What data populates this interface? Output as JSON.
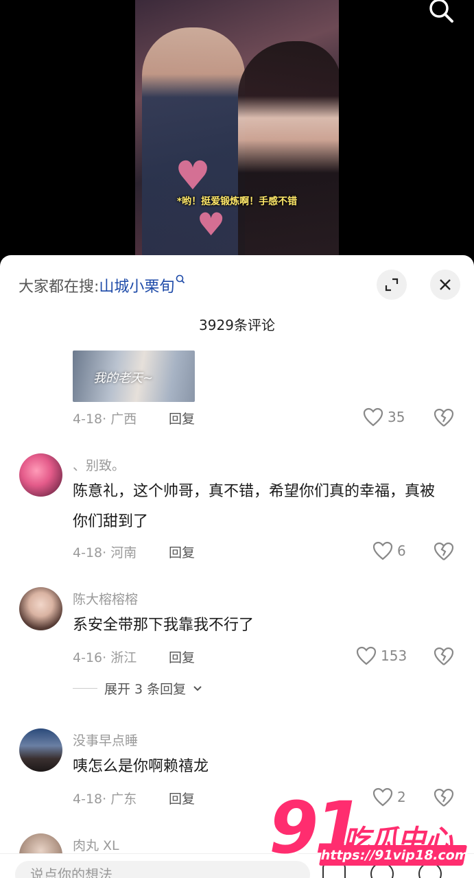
{
  "video": {
    "caption": "*哟！挺爱锻炼啊！手感不错"
  },
  "sheet": {
    "search_prefix": "大家都在搜:",
    "search_keyword": "山城小栗旬",
    "comment_count_title": "3929条评论",
    "reply_label": "回复"
  },
  "comments": [
    {
      "image_caption": "我的老天~",
      "meta": "4-18· 广西",
      "likes": "35"
    },
    {
      "username": "、别致。",
      "text": "陈意礼，这个帅哥，真不错，希望你们真的幸福，真被你们甜到了",
      "meta": "4-18· 河南",
      "likes": "6"
    },
    {
      "username": "陈大榕榕榕",
      "text": "系安全带那下我靠我不行了",
      "meta": "4-16· 浙江",
      "likes": "153",
      "expand_label": "展开 3 条回复"
    },
    {
      "username": "没事早点睡",
      "text": "咦怎么是你啊赖禧龙",
      "meta": "4-18· 广东",
      "likes": "2"
    },
    {
      "username": "肉丸 XL"
    }
  ],
  "bottom": {
    "input_placeholder": "说点你的想法"
  },
  "watermark": {
    "number": "91",
    "brand": "吃瓜中心",
    "url": "https://91vip18.com"
  },
  "colors": {
    "accent_link": "#1d4aa8",
    "watermark": "#ff2d6f"
  }
}
